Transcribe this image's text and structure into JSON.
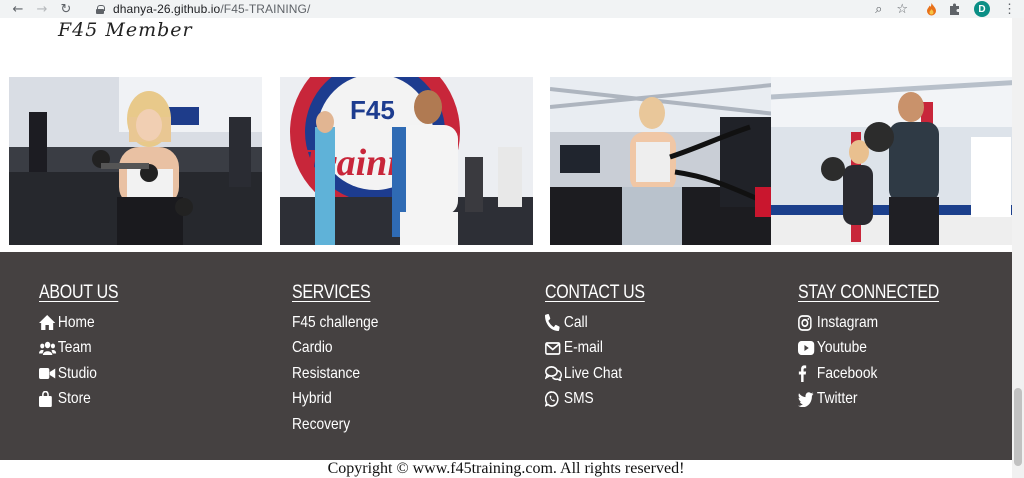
{
  "browser": {
    "url_host": "dhanya-26.github.io",
    "url_path": "/F45-TRAINING/",
    "profile_initial": "D"
  },
  "page": {
    "member_title": "F45 Member",
    "photos": [
      {
        "icon": "photo-dumbbell-curl"
      },
      {
        "icon": "photo-f45-training-wall"
      },
      {
        "icon": "photo-battle-ropes"
      },
      {
        "icon": "photo-wall-ball"
      }
    ]
  },
  "footer": {
    "about": {
      "heading": "ABOUT US",
      "items": [
        {
          "label": "Home",
          "icon": "home-icon"
        },
        {
          "label": "Team",
          "icon": "users-icon"
        },
        {
          "label": "Studio",
          "icon": "video-camera-icon"
        },
        {
          "label": "Store",
          "icon": "shopping-bag-icon"
        }
      ]
    },
    "services": {
      "heading": "SERVICES",
      "items": [
        {
          "label": "F45 challenge"
        },
        {
          "label": "Cardio"
        },
        {
          "label": "Resistance"
        },
        {
          "label": "Hybrid"
        },
        {
          "label": "Recovery"
        }
      ]
    },
    "contact": {
      "heading": "CONTACT US",
      "items": [
        {
          "label": "Call",
          "icon": "phone-icon"
        },
        {
          "label": "E-mail",
          "icon": "envelope-icon"
        },
        {
          "label": "Live Chat",
          "icon": "chat-icon"
        },
        {
          "label": "SMS",
          "icon": "whatsapp-icon"
        }
      ]
    },
    "social": {
      "heading": "STAY CONNECTED",
      "items": [
        {
          "label": "Instagram",
          "icon": "instagram-icon"
        },
        {
          "label": "Youtube",
          "icon": "youtube-icon"
        },
        {
          "label": "Facebook",
          "icon": "facebook-icon"
        },
        {
          "label": "Twitter",
          "icon": "twitter-icon"
        }
      ]
    },
    "copyright": "Copyright © www.f45training.com. All rights reserved!"
  },
  "colors": {
    "footer_bg": "#454141",
    "footer_text": "#ffffff"
  }
}
